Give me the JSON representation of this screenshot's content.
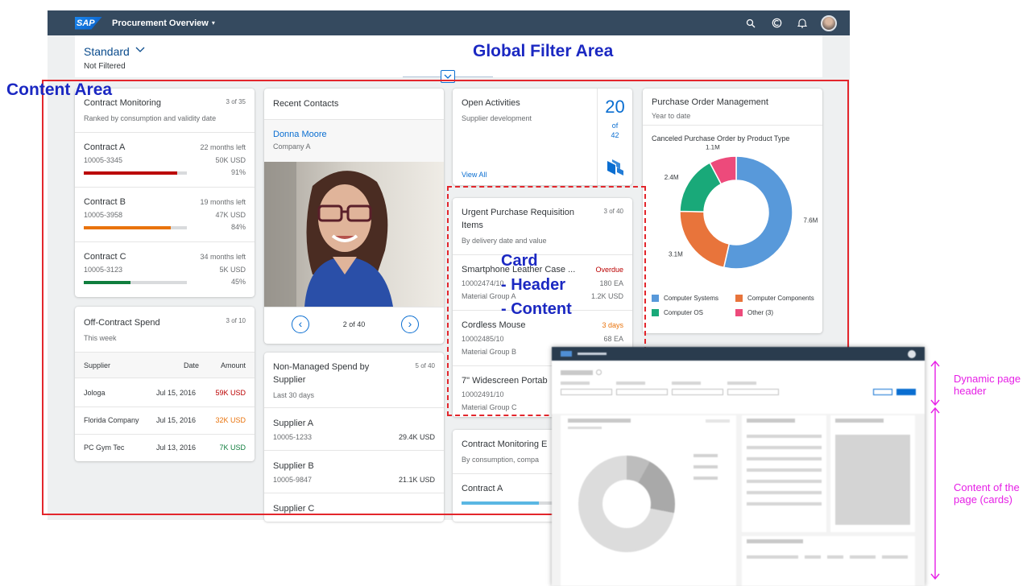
{
  "shell": {
    "logo": "SAP",
    "title": "Procurement Overview",
    "caret": "▾",
    "icons": [
      "search-icon",
      "copilot-icon",
      "bell-icon",
      "user-avatar"
    ]
  },
  "filter": {
    "variant": "Standard",
    "status": "Not Filtered"
  },
  "annotations": {
    "global_filter": "Global Filter Area",
    "content_area": "Content Area",
    "card": "Card",
    "header": "- Header",
    "content": "- Content",
    "dynamic_header": [
      "Dynamic page",
      "header"
    ],
    "content_of_page": [
      "Content of the",
      "page (cards)"
    ]
  },
  "contract_monitoring": {
    "title": "Contract Monitoring",
    "count": "3 of 35",
    "subtitle": "Ranked by consumption and validity date",
    "items": [
      {
        "name": "Contract A",
        "left": "22 months left",
        "id": "10005-3345",
        "amount": "50K USD",
        "pct": "91%",
        "fill": 0.91,
        "color": "#bb0000"
      },
      {
        "name": "Contract B",
        "left": "19 months left",
        "id": "10005-3958",
        "amount": "47K USD",
        "pct": "84%",
        "fill": 0.84,
        "color": "#e9730c"
      },
      {
        "name": "Contract C",
        "left": "34 months left",
        "id": "10005-3123",
        "amount": "5K USD",
        "pct": "45%",
        "fill": 0.45,
        "color": "#107e3e"
      }
    ]
  },
  "off_contract": {
    "title": "Off-Contract Spend",
    "count": "3 of 10",
    "subtitle": "This week",
    "headers": [
      "Supplier",
      "Date",
      "Amount"
    ],
    "rows": [
      {
        "supplier": "Jologa",
        "date": "Jul 15, 2016",
        "amount": "59K USD",
        "tone": "red"
      },
      {
        "supplier": "Florida Company",
        "date": "Jul 15, 2016",
        "amount": "32K USD",
        "tone": "orange"
      },
      {
        "supplier": "PC Gym Tec",
        "date": "Jul 13, 2016",
        "amount": "7K USD",
        "tone": "green"
      }
    ]
  },
  "recent_contacts": {
    "title": "Recent Contacts",
    "name": "Donna Moore",
    "company": "Company A",
    "pager": "2 of 40",
    "prev": "‹",
    "next": "›"
  },
  "non_managed": {
    "title_1": "Non-Managed Spend by",
    "title_2": "Supplier",
    "count": "5 of 40",
    "subtitle": "Last 30 days",
    "items": [
      {
        "name": "Supplier A",
        "id": "10005-1233",
        "amount": "29.4K USD"
      },
      {
        "name": "Supplier B",
        "id": "10005-9847",
        "amount": "21.1K USD"
      },
      {
        "name": "Supplier C"
      }
    ]
  },
  "open_activities": {
    "title": "Open Activities",
    "subtitle": "Supplier development",
    "value": "20",
    "of": "of",
    "total": "42",
    "link": "View All"
  },
  "urgent_pr": {
    "title_1": "Urgent Purchase Requisition",
    "title_2": "Items",
    "count": "3 of 40",
    "subtitle": "By delivery date and value",
    "items": [
      {
        "name": "Smartphone Leather Case ...",
        "status": "Overdue",
        "id": "10002474/10",
        "qty": "180 EA",
        "group": "Material Group A",
        "amount": "1.2K USD",
        "tone": "red"
      },
      {
        "name": "Cordless Mouse",
        "status": "3 days",
        "id": "10002485/10",
        "qty": "68 EA",
        "group": "Material Group B",
        "amount": "",
        "tone": "orange"
      },
      {
        "name": "7\" Widescreen Portab",
        "status": "",
        "id": "10002491/10",
        "qty": "",
        "group": "Material Group C",
        "amount": "",
        "tone": ""
      }
    ]
  },
  "contract_monitoring_2": {
    "title": "Contract Monitoring E",
    "subtitle": "By consumption, compa",
    "item": "Contract A",
    "fill": 0.75
  },
  "po_management": {
    "title": "Purchase Order Management",
    "subtitle": "Year to date",
    "chart_title": "Canceled Purchase Order by Product Type"
  },
  "chart_data": {
    "type": "pie",
    "title": "Canceled Purchase Order by Product Type",
    "categories": [
      "Computer Systems",
      "Computer Components",
      "Computer OS",
      "Other (3)"
    ],
    "values": [
      7.6,
      3.1,
      2.4,
      1.1
    ],
    "labels": [
      "7.6M",
      "3.1M",
      "2.4M",
      "1.1M"
    ],
    "colors": [
      "#5899da",
      "#e8743b",
      "#19a979",
      "#ed4a7b"
    ],
    "donut": true,
    "legend": "bottom"
  }
}
